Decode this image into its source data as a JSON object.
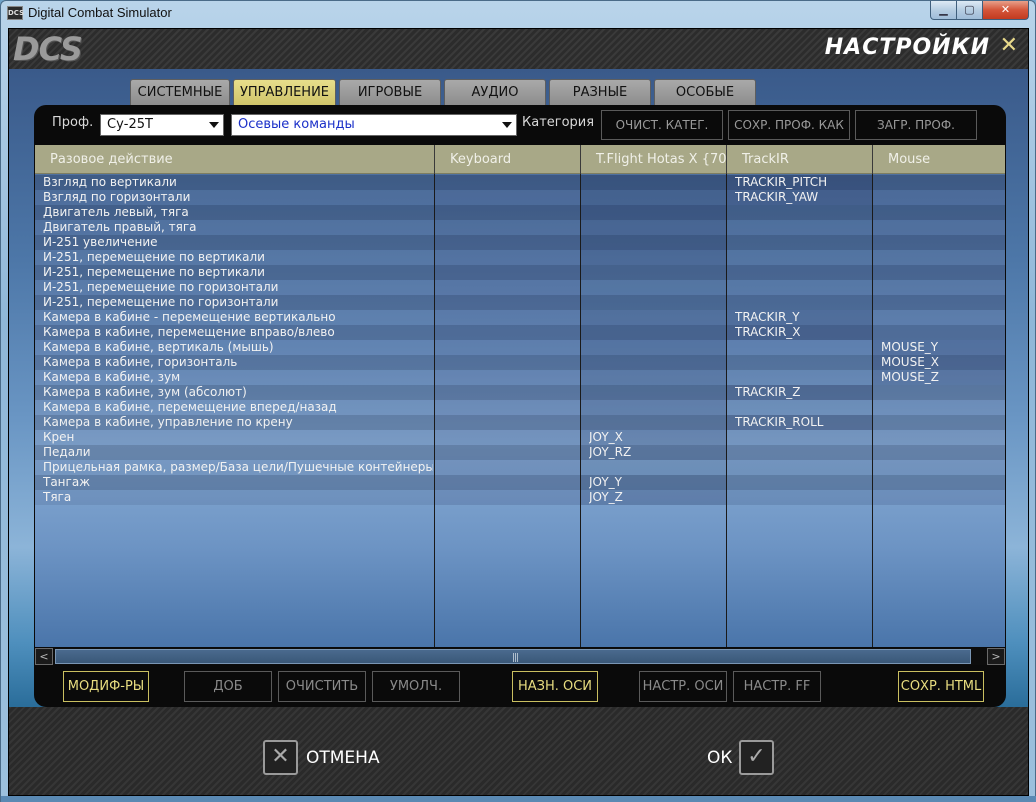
{
  "window": {
    "title": "Digital Combat Simulator",
    "min": "▁",
    "max": "▢",
    "close": "✕"
  },
  "header": {
    "logo": "DCS",
    "title": "НАСТРОЙКИ",
    "close": "✕"
  },
  "tabs": [
    {
      "label": "СИСТЕМНЫЕ",
      "active": false
    },
    {
      "label": "УПРАВЛЕНИЕ",
      "active": true
    },
    {
      "label": "ИГРОВЫЕ",
      "active": false
    },
    {
      "label": "АУДИО",
      "active": false
    },
    {
      "label": "РАЗНЫЕ",
      "active": false
    },
    {
      "label": "ОСОБЫЕ",
      "active": false
    }
  ],
  "toolbar": {
    "profile_label": "Проф.",
    "profile_value": "Су-25Т",
    "category_value": "Осевые команды",
    "category_label": "Категория",
    "clear_category": "ОЧИСТ. КАТЕГ.",
    "save_profile_as": "СОХР. ПРОФ. КАК",
    "load_profile": "ЗАГР. ПРОФ."
  },
  "grid": {
    "columns": [
      "Разовое действие",
      "Keyboard",
      "T.Flight Hotas X {70",
      "TrackIR",
      "Mouse"
    ],
    "rows": [
      {
        "action": "Взгляд по вертикали",
        "keyboard": "",
        "joystick": "",
        "trackir": "TRACKIR_PITCH",
        "mouse": ""
      },
      {
        "action": "Взгляд по горизонтали",
        "keyboard": "",
        "joystick": "",
        "trackir": "TRACKIR_YAW",
        "mouse": ""
      },
      {
        "action": "Двигатель левый, тяга",
        "keyboard": "",
        "joystick": "",
        "trackir": "",
        "mouse": ""
      },
      {
        "action": "Двигатель правый, тяга",
        "keyboard": "",
        "joystick": "",
        "trackir": "",
        "mouse": ""
      },
      {
        "action": "И-251 увеличение",
        "keyboard": "",
        "joystick": "",
        "trackir": "",
        "mouse": ""
      },
      {
        "action": "И-251, перемещение по вертикали",
        "keyboard": "",
        "joystick": "",
        "trackir": "",
        "mouse": ""
      },
      {
        "action": "И-251, перемещение по вертикали",
        "keyboard": "",
        "joystick": "",
        "trackir": "",
        "mouse": ""
      },
      {
        "action": "И-251, перемещение по горизонтали",
        "keyboard": "",
        "joystick": "",
        "trackir": "",
        "mouse": ""
      },
      {
        "action": "И-251, перемещение по горизонтали",
        "keyboard": "",
        "joystick": "",
        "trackir": "",
        "mouse": ""
      },
      {
        "action": "Камера в кабине - перемещение вертикально",
        "keyboard": "",
        "joystick": "",
        "trackir": "TRACKIR_Y",
        "mouse": ""
      },
      {
        "action": "Камера в кабине,  перемещение вправо/влево",
        "keyboard": "",
        "joystick": "",
        "trackir": "TRACKIR_X",
        "mouse": ""
      },
      {
        "action": "Камера в кабине, вертикаль (мышь)",
        "keyboard": "",
        "joystick": "",
        "trackir": "",
        "mouse": "MOUSE_Y"
      },
      {
        "action": "Камера в кабине, горизонталь",
        "keyboard": "",
        "joystick": "",
        "trackir": "",
        "mouse": "MOUSE_X"
      },
      {
        "action": "Камера в кабине, зум",
        "keyboard": "",
        "joystick": "",
        "trackir": "",
        "mouse": "MOUSE_Z"
      },
      {
        "action": "Камера в кабине, зум (абсолют)",
        "keyboard": "",
        "joystick": "",
        "trackir": "TRACKIR_Z",
        "mouse": ""
      },
      {
        "action": "Камера в кабине, перемещение вперед/назад",
        "keyboard": "",
        "joystick": "",
        "trackir": "",
        "mouse": ""
      },
      {
        "action": "Камера в кабине, управление по крену",
        "keyboard": "",
        "joystick": "",
        "trackir": "TRACKIR_ROLL",
        "mouse": ""
      },
      {
        "action": "Крен",
        "keyboard": "",
        "joystick": "JOY_X",
        "trackir": "",
        "mouse": ""
      },
      {
        "action": "Педали",
        "keyboard": "",
        "joystick": "JOY_RZ",
        "trackir": "",
        "mouse": ""
      },
      {
        "action": "Прицельная рамка, размер/База цели/Пушечные контейнеры, угол",
        "keyboard": "",
        "joystick": "",
        "trackir": "",
        "mouse": ""
      },
      {
        "action": "Тангаж",
        "keyboard": "",
        "joystick": "JOY_Y",
        "trackir": "",
        "mouse": ""
      },
      {
        "action": "Тяга",
        "keyboard": "",
        "joystick": "JOY_Z",
        "trackir": "",
        "mouse": ""
      }
    ]
  },
  "scroll": {
    "left": "<",
    "right": ">",
    "grip": "|||"
  },
  "bottom_buttons": {
    "modifiers": "МОДИФ-РЫ",
    "add": "ДОБ",
    "clear": "ОЧИСТИТЬ",
    "default": "УМОЛЧ.",
    "assign_axis": "НАЗН. ОСИ",
    "axis_tune": "НАСТР. ОСИ",
    "ff_tune": "НАСТР. FF",
    "save_html": "СОХР. HTML"
  },
  "footer": {
    "cancel": "ОТМЕНА",
    "cancel_icon": "✕",
    "ok": "ОК",
    "ok_icon": "✓"
  }
}
